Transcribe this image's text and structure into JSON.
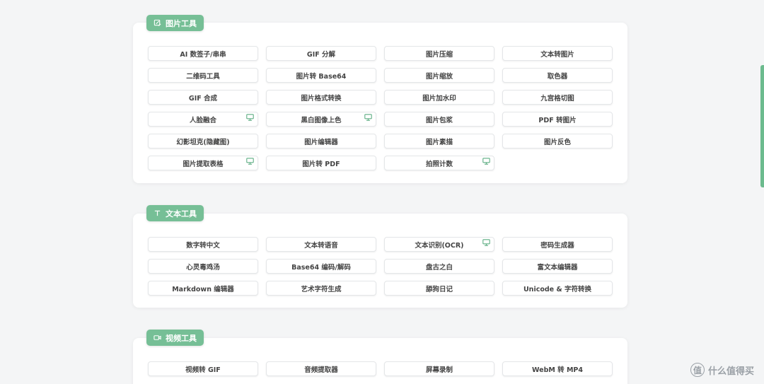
{
  "sections": [
    {
      "title": "图片工具",
      "icon": "image-edit-icon",
      "tools": [
        {
          "label": "AI 数签子/串串",
          "badge": false
        },
        {
          "label": "GIF 分解",
          "badge": false
        },
        {
          "label": "图片压缩",
          "badge": false
        },
        {
          "label": "文本转图片",
          "badge": false
        },
        {
          "label": "二维码工具",
          "badge": false
        },
        {
          "label": "图片转 Base64",
          "badge": false
        },
        {
          "label": "图片缩放",
          "badge": false
        },
        {
          "label": "取色器",
          "badge": false
        },
        {
          "label": "GIF 合成",
          "badge": false
        },
        {
          "label": "图片格式转换",
          "badge": false
        },
        {
          "label": "图片加水印",
          "badge": false
        },
        {
          "label": "九宫格切图",
          "badge": false
        },
        {
          "label": "人脸融合",
          "badge": true
        },
        {
          "label": "黑白图像上色",
          "badge": true
        },
        {
          "label": "图片包浆",
          "badge": false
        },
        {
          "label": "PDF 转图片",
          "badge": false
        },
        {
          "label": "幻影坦克(隐藏图)",
          "badge": false
        },
        {
          "label": "图片编辑器",
          "badge": false
        },
        {
          "label": "图片素描",
          "badge": false
        },
        {
          "label": "图片反色",
          "badge": false
        },
        {
          "label": "图片提取表格",
          "badge": true
        },
        {
          "label": "图片转 PDF",
          "badge": false
        },
        {
          "label": "拍照计数",
          "badge": true
        }
      ]
    },
    {
      "title": "文本工具",
      "icon": "text-icon",
      "tools": [
        {
          "label": "数字转中文",
          "badge": false
        },
        {
          "label": "文本转语音",
          "badge": false
        },
        {
          "label": "文本识别(OCR)",
          "badge": true
        },
        {
          "label": "密码生成器",
          "badge": false
        },
        {
          "label": "心灵毒鸡汤",
          "badge": false
        },
        {
          "label": "Base64 编码/解码",
          "badge": false
        },
        {
          "label": "盘古之白",
          "badge": false
        },
        {
          "label": "富文本编辑器",
          "badge": false
        },
        {
          "label": "Markdown 编辑器",
          "badge": false
        },
        {
          "label": "艺术字符生成",
          "badge": false
        },
        {
          "label": "舔狗日记",
          "badge": false
        },
        {
          "label": "Unicode & 字符转换",
          "badge": false
        }
      ]
    },
    {
      "title": "视频工具",
      "icon": "video-camera-icon",
      "tools": [
        {
          "label": "视频转 GIF",
          "badge": false
        },
        {
          "label": "音频提取器",
          "badge": false
        },
        {
          "label": "屏幕录制",
          "badge": false
        },
        {
          "label": "WebM 转 MP4",
          "badge": false
        }
      ]
    }
  ],
  "watermark": {
    "logo": "值",
    "text": "什么值得买"
  },
  "colors": {
    "accent": "#76bf96",
    "badge": "#5fae83",
    "background": "#f4f5f6"
  }
}
